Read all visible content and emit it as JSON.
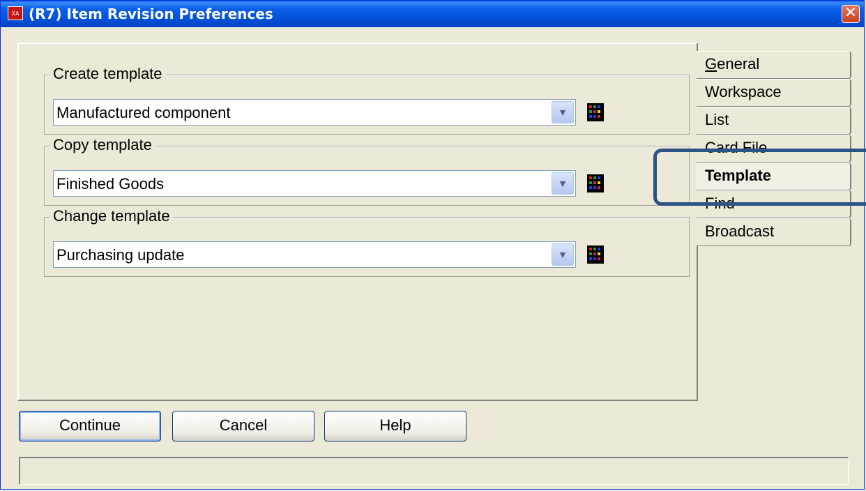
{
  "window": {
    "title": "(R7) Item Revision Preferences",
    "icon_text": "XA",
    "close_glyph": "✕"
  },
  "groups": [
    {
      "label": "Create template",
      "value": "Manufactured component"
    },
    {
      "label": "Copy template",
      "value": "Finished Goods"
    },
    {
      "label": "Change template",
      "value": "Purchasing update"
    }
  ],
  "tabs": [
    {
      "label": "General",
      "accesskey": "G",
      "rest": "eneral"
    },
    {
      "label": "Workspace"
    },
    {
      "label": "List"
    },
    {
      "label": "Card File"
    },
    {
      "label": "Template",
      "active": true
    },
    {
      "label": "Find"
    },
    {
      "label": "Broadcast"
    }
  ],
  "buttons": {
    "continue": "Continue",
    "cancel": "Cancel",
    "help": "Help"
  },
  "status_text": "",
  "colors": {
    "titlebar": "#0A5FE8",
    "highlight_box": "#2D5286",
    "window_bg": "#ECE9D8"
  }
}
